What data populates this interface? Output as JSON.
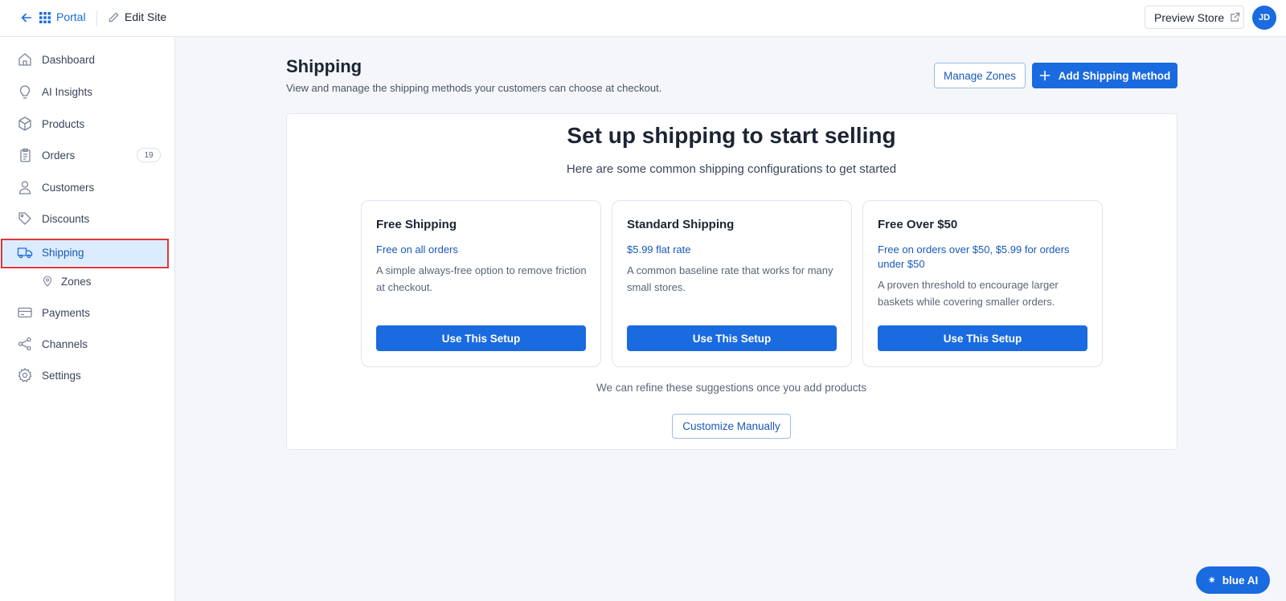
{
  "topbar": {
    "portal_label": "Portal",
    "edit_site_label": "Edit Site",
    "preview_store_label": "Preview Store",
    "avatar_initials": "JD"
  },
  "sidebar": {
    "items": [
      {
        "label": "Dashboard",
        "icon": "home-icon"
      },
      {
        "label": "AI Insights",
        "icon": "lightbulb-icon"
      },
      {
        "label": "Products",
        "icon": "box-icon"
      },
      {
        "label": "Orders",
        "icon": "clipboard-icon",
        "badge": "19"
      },
      {
        "label": "Customers",
        "icon": "user-icon"
      },
      {
        "label": "Discounts",
        "icon": "tag-icon"
      },
      {
        "label": "Shipping",
        "icon": "truck-icon",
        "active": true
      },
      {
        "label": "Zones",
        "icon": "location-pin-icon",
        "sub": true
      },
      {
        "label": "Payments",
        "icon": "credit-card-icon"
      },
      {
        "label": "Channels",
        "icon": "share-icon"
      },
      {
        "label": "Settings",
        "icon": "gear-icon"
      }
    ]
  },
  "main": {
    "title": "Shipping",
    "subtitle": "View and manage the shipping methods your customers can choose at checkout.",
    "manage_zones_label": "Manage Zones",
    "add_method_label": "Add Shipping Method",
    "panel": {
      "title": "Set up shipping to start selling",
      "subtitle": "Here are some common shipping configurations to get started",
      "cards": [
        {
          "title": "Free Shipping",
          "rate": "Free on all orders",
          "description": "A simple always-free option to remove friction at checkout.",
          "button": "Use This Setup"
        },
        {
          "title": "Standard Shipping",
          "rate": "$5.99 flat rate",
          "description": "A common baseline rate that works for many small stores.",
          "button": "Use This Setup"
        },
        {
          "title": "Free Over $50",
          "rate": "Free on orders over $50, $5.99 for orders under $50",
          "description": "A proven threshold to encourage larger baskets while covering smaller orders.",
          "button": "Use This Setup"
        }
      ],
      "note": "We can refine these suggestions once you add products",
      "customize_label": "Customize Manually"
    }
  },
  "assistant": {
    "label": "blue AI"
  },
  "colors": {
    "accent": "#1a6ae0",
    "highlight": "#e0353a"
  }
}
